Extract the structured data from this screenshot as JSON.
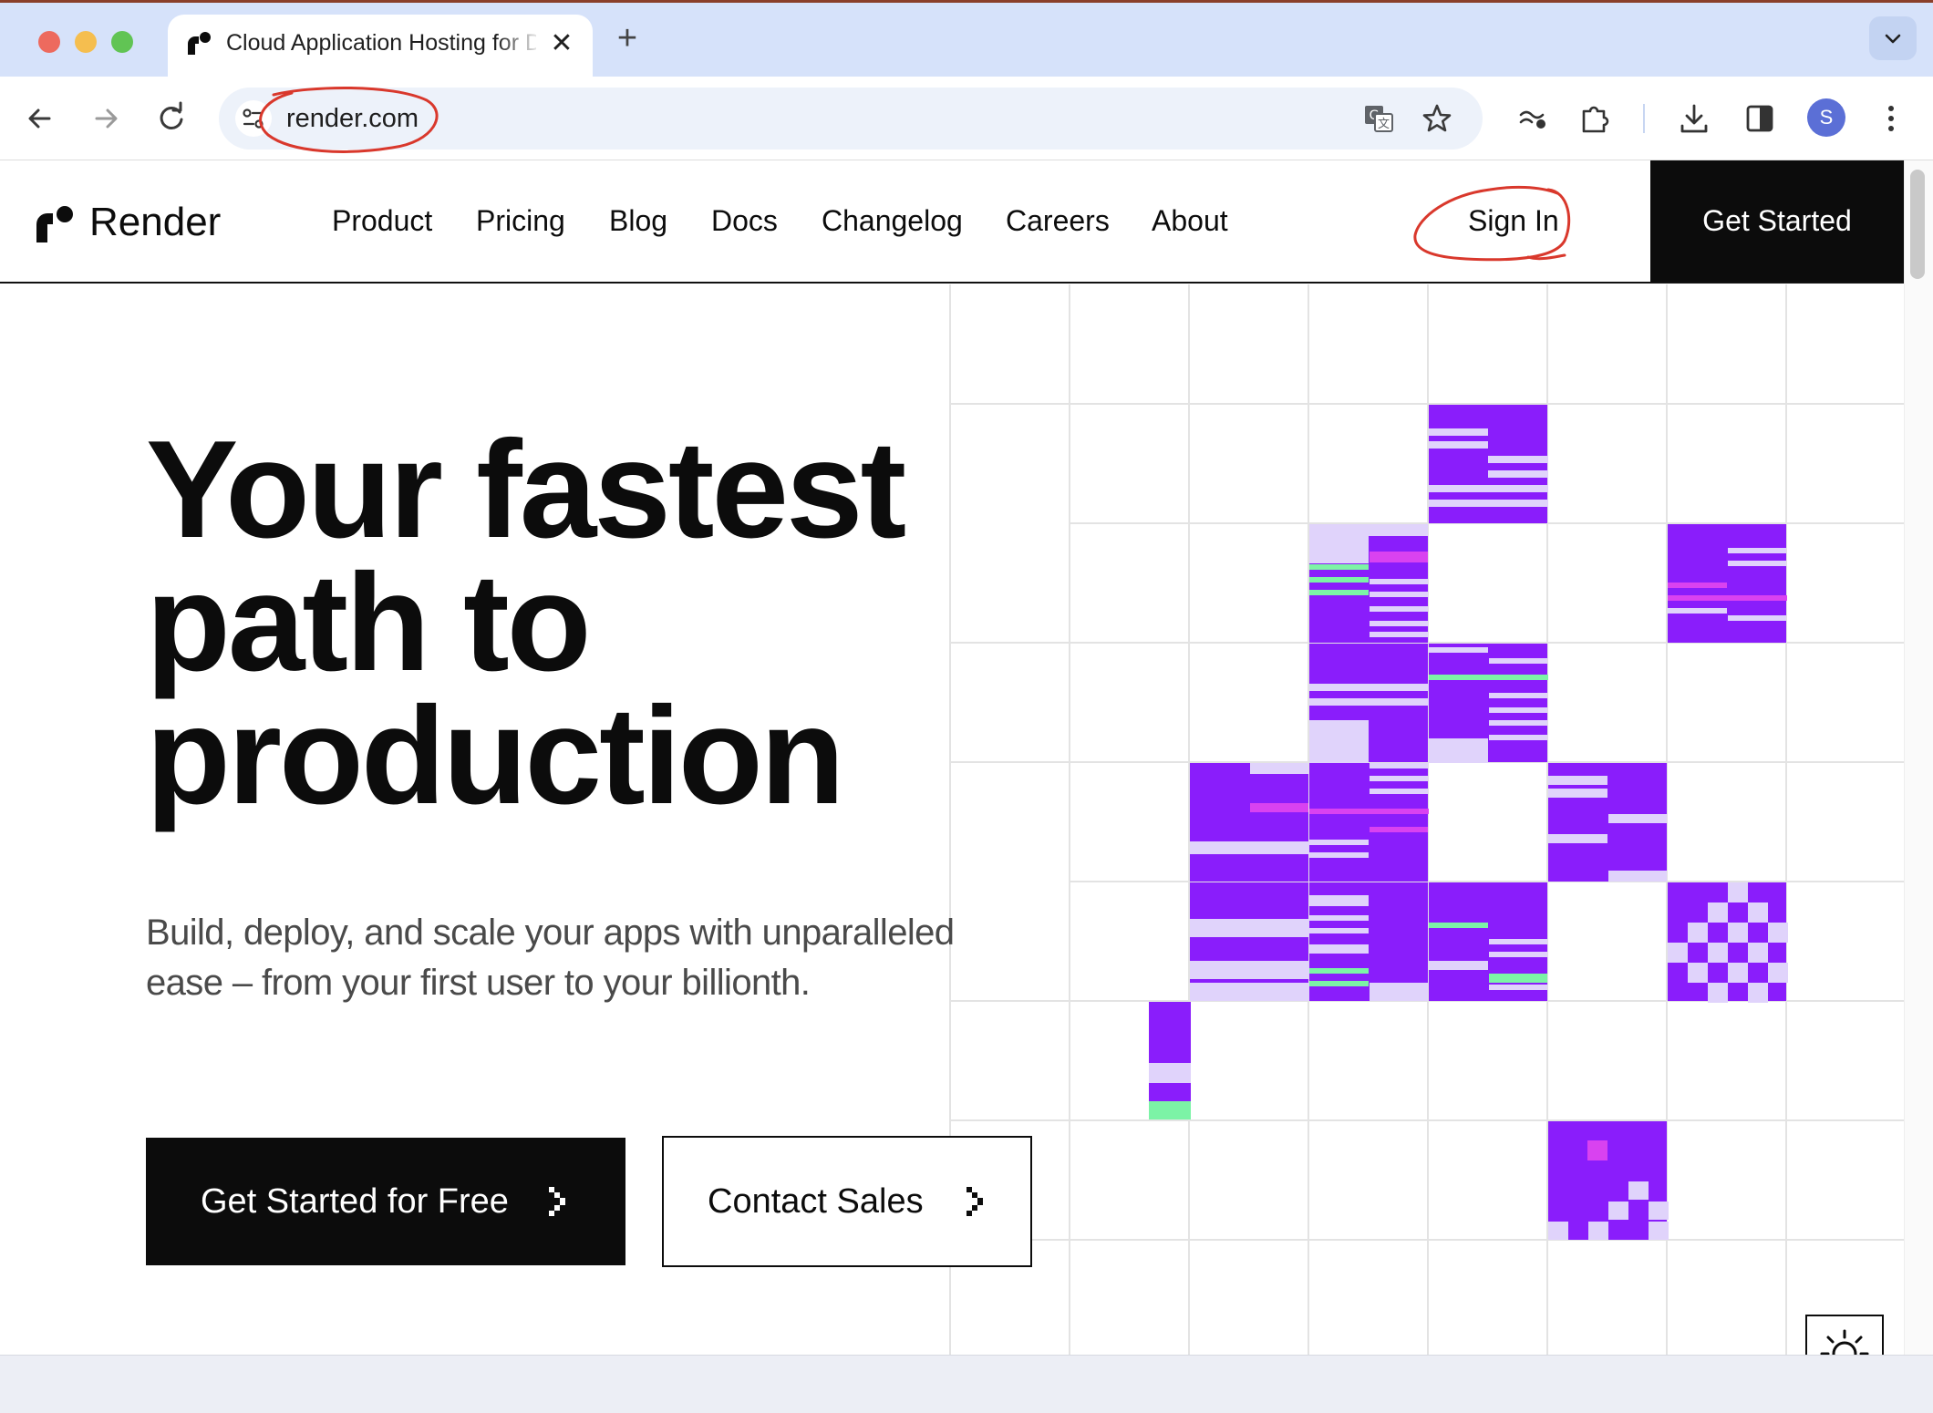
{
  "browser": {
    "tab_title": "Cloud Application Hosting for Developers",
    "url": "render.com",
    "profile_initial": "S"
  },
  "nav": {
    "brand": "Render",
    "links": [
      "Product",
      "Pricing",
      "Blog",
      "Docs",
      "Changelog",
      "Careers",
      "About"
    ],
    "sign_in": "Sign In",
    "get_started": "Get Started"
  },
  "hero": {
    "title_lines": [
      "Your fastest",
      "path to",
      "production"
    ],
    "subtitle": "Build, deploy, and scale your apps with unparalleled ease – from your first user to your billionth.",
    "primary_cta": "Get Started for Free",
    "secondary_cta": "Contact Sales"
  },
  "colors": {
    "brand_purple": "#8a1dfb",
    "accent_lavender": "#e0d3fb",
    "accent_green": "#7cf3a6",
    "accent_magenta": "#d942f0",
    "annotation_red": "#d9382c",
    "ink": "#0c0c0c"
  },
  "icons": {
    "back": "arrow-left-icon",
    "forward": "arrow-right-icon",
    "reload": "reload-icon",
    "translate": "translate-icon",
    "bookmark": "star-icon",
    "extensions": "puzzle-icon",
    "downloads": "download-icon",
    "theme": "sun-icon"
  }
}
